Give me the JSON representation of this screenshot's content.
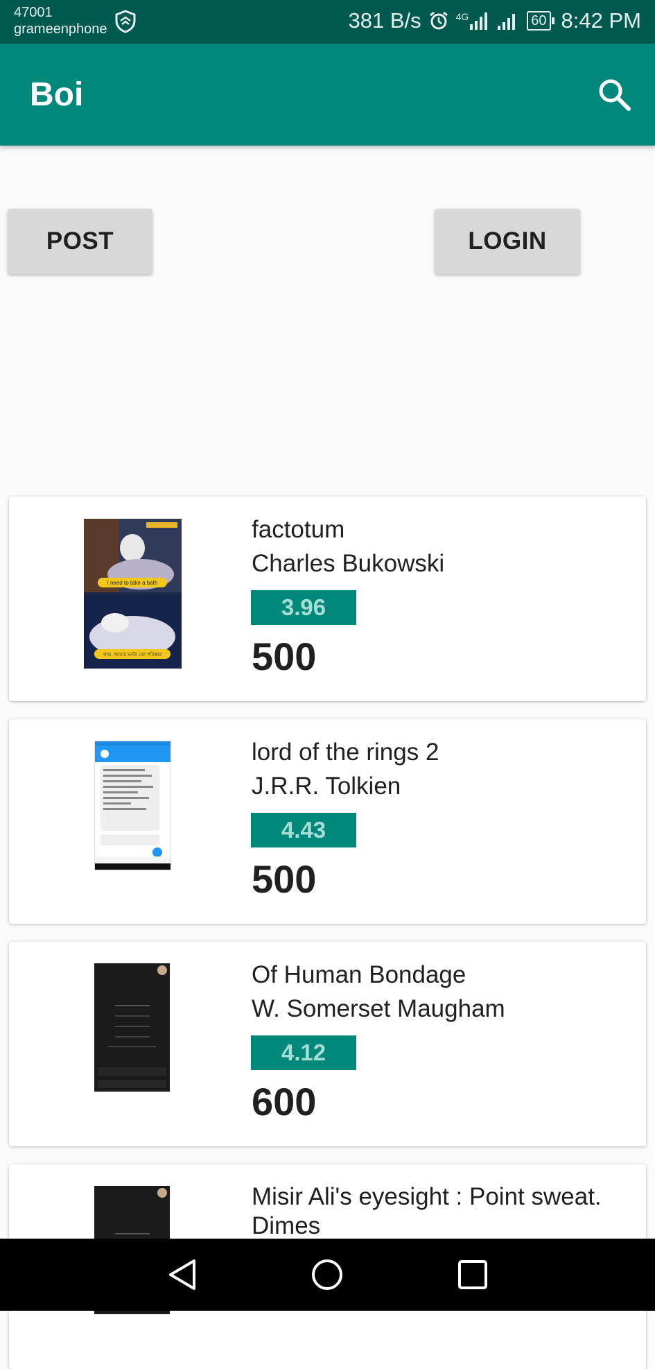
{
  "status_bar": {
    "code": "47001",
    "carrier": "grameenphone",
    "speed": "381 B/s",
    "network": "4G",
    "battery": "60",
    "time": "8:42 PM"
  },
  "app_bar": {
    "title": "Boi",
    "search_icon": "search-icon"
  },
  "actions": {
    "post_label": "POST",
    "login_label": "LOGIN"
  },
  "books": [
    {
      "title": "factotum",
      "author": "Charles Bukowski",
      "rating": "3.96",
      "price": "500",
      "thumb_caption_top": "I need to take a bath",
      "thumb_caption_bottom": "থাক, আমার মনটা তো পরিষ্কার"
    },
    {
      "title": "lord of the rings 2",
      "author": "J.R.R. Tolkien",
      "rating": "4.43",
      "price": "500"
    },
    {
      "title": "Of Human Bondage",
      "author": "W. Somerset Maugham",
      "rating": "4.12",
      "price": "600"
    },
    {
      "title": "Misir Ali's eyesight : Point sweat. Dimes",
      "author": "",
      "rating": "",
      "price": ""
    }
  ],
  "colors": {
    "primary": "#00897b",
    "status_bar": "#00594f",
    "button": "#d8d8d8"
  },
  "nav": {
    "back_icon": "back-triangle-icon",
    "home_icon": "home-circle-icon",
    "recents_icon": "recents-square-icon"
  }
}
